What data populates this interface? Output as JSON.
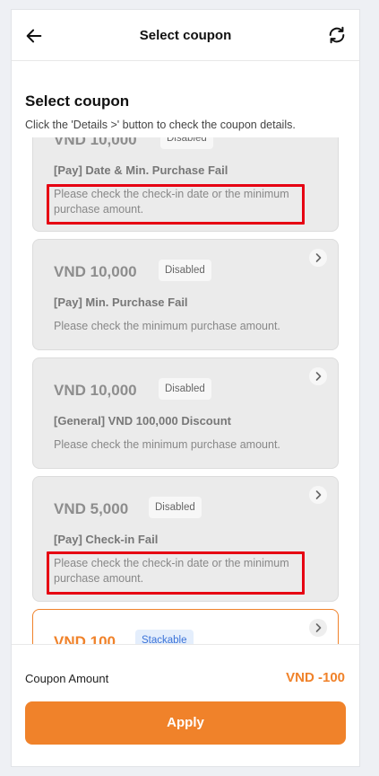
{
  "header": {
    "title": "Select coupon",
    "back_icon": "arrow-left-icon",
    "refresh_icon": "refresh-icon"
  },
  "section": {
    "title": "Select coupon",
    "subtitle": "Click the 'Details >' button to check the coupon details."
  },
  "coupons": [
    {
      "amount": "VND 10,000",
      "badge": "Disabled",
      "name": "[Pay] Date & Min. Purchase Fail",
      "description": "Please check the check-in date or the minimum purchase amount.",
      "state": "disabled"
    },
    {
      "amount": "VND 10,000",
      "badge": "Disabled",
      "name": "[Pay] Min. Purchase Fail",
      "description": "Please check the minimum purchase amount.",
      "state": "disabled"
    },
    {
      "amount": "VND 10,000",
      "badge": "Disabled",
      "name": "[General] VND 100,000 Discount",
      "description": "Please check the minimum purchase amount.",
      "state": "disabled"
    },
    {
      "amount": "VND 5,000",
      "badge": "Disabled",
      "name": "[Pay] Check-in Fail",
      "description": "Please check the check-in date or the minimum purchase amount.",
      "state": "disabled"
    },
    {
      "amount": "VND 100",
      "badge": "Stackable",
      "name": "",
      "description": "",
      "state": "selected"
    }
  ],
  "footer": {
    "coupon_amount_label": "Coupon Amount",
    "coupon_amount_value": "VND -100",
    "apply_label": "Apply"
  },
  "colors": {
    "accent": "#f0822a",
    "highlight": "#e60012",
    "stackable_badge": "#3b73d8"
  }
}
